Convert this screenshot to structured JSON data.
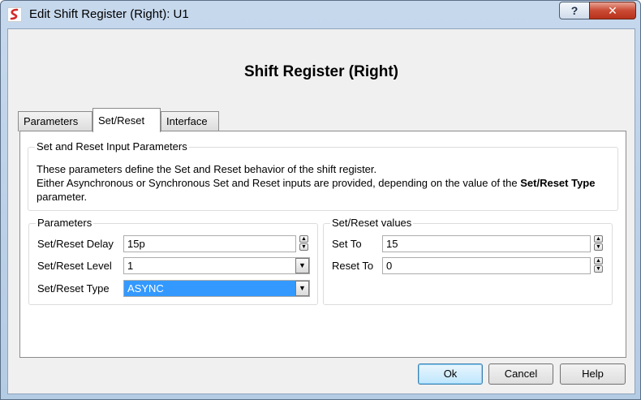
{
  "window": {
    "title": "Edit Shift Register (Right): U1",
    "help_glyph": "?",
    "close_glyph": "✕"
  },
  "heading": "Shift Register (Right)",
  "tabs": [
    {
      "label": "Parameters",
      "active": false
    },
    {
      "label": "Set/Reset",
      "active": true
    },
    {
      "label": "Interface",
      "active": false
    }
  ],
  "info_group": {
    "title": "Set and Reset Input Parameters",
    "line1": "These parameters define the Set and Reset behavior of the shift register.",
    "line2_pre": "Either Asynchronous or Synchronous Set and Reset inputs are provided, depending on the value of the ",
    "line2_bold": "Set/Reset Type",
    "line2_post": " parameter."
  },
  "params_group": {
    "title": "Parameters",
    "delay_label": "Set/Reset Delay",
    "delay_value": "15p",
    "level_label": "Set/Reset Level",
    "level_value": "1",
    "type_label": "Set/Reset Type",
    "type_value": "ASYNC"
  },
  "values_group": {
    "title": "Set/Reset values",
    "set_label": "Set To",
    "set_value": "15",
    "reset_label": "Reset To",
    "reset_value": "0"
  },
  "buttons": {
    "ok": "Ok",
    "cancel": "Cancel",
    "help": "Help"
  },
  "glyphs": {
    "spin_up": "▲",
    "spin_down": "▼",
    "dropdown": "▼"
  },
  "colors": {
    "selection": "#3399ff",
    "close_button": "#c94a33",
    "app_icon": "#d42a2a"
  }
}
